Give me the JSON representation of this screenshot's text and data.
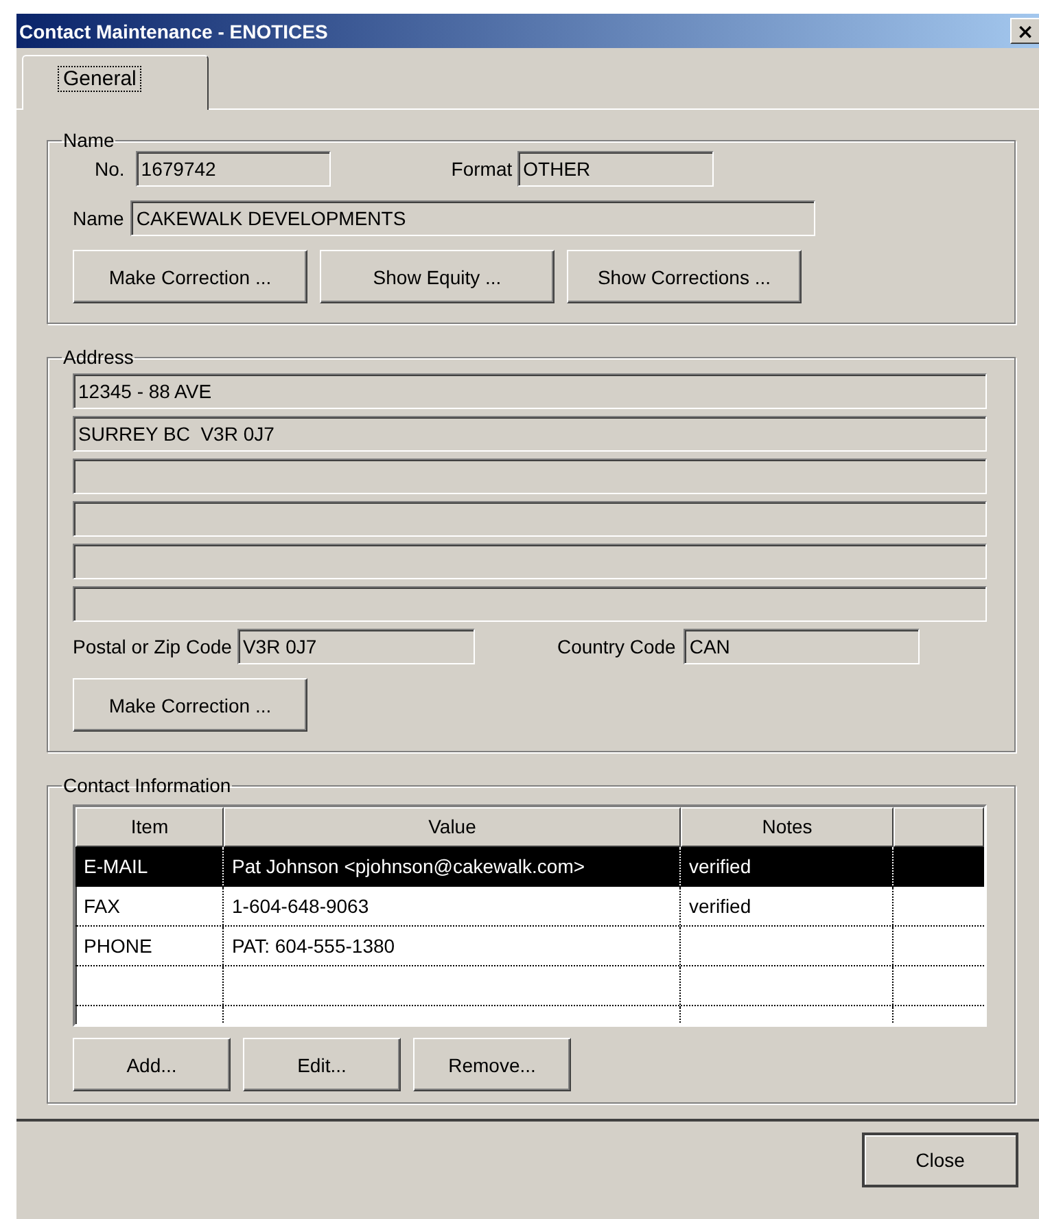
{
  "window": {
    "title": "Contact Maintenance - ENOTICES",
    "close_glyph": "×"
  },
  "tabs": [
    {
      "label": "General",
      "selected": true
    }
  ],
  "name_group": {
    "title": "Name",
    "number_label": "No.",
    "number": "1679742",
    "format_label": "Format",
    "format": "OTHER",
    "name_label": "Name",
    "name": "CAKEWALK DEVELOPMENTS",
    "buttons": [
      "Make Correction ...",
      "Show Equity ...",
      "Show Corrections ..."
    ]
  },
  "address_group": {
    "title": "Address",
    "lines": [
      {
        "kind": "filled",
        "value": "12345 - 88 AVE"
      },
      {
        "kind": "filled",
        "value": "SURREY BC  V3R 0J7"
      },
      {
        "kind": "empty"
      },
      {
        "kind": "empty"
      },
      {
        "kind": "empty"
      },
      {
        "kind": "empty"
      }
    ],
    "postal_label": "Postal or Zip Code",
    "postal": "V3R 0J7",
    "country_label": "Country Code",
    "country": "CAN",
    "buttons": [
      "Make Correction ..."
    ]
  },
  "contact_group": {
    "title": "Contact Information",
    "table": {
      "columns": [
        {
          "kind": "text",
          "label": "Item"
        },
        {
          "kind": "text",
          "label": "Value"
        },
        {
          "kind": "text",
          "label": "Notes"
        },
        {
          "kind": "blank"
        }
      ],
      "rows": [
        {
          "kind": "filled",
          "selected": true,
          "item": "E-MAIL",
          "value": "Pat Johnson <pjohnson@cakewalk.com>",
          "notes": "verified"
        },
        {
          "kind": "filled",
          "selected": false,
          "item": "FAX",
          "value": "1-604-648-9063",
          "notes": "verified"
        },
        {
          "kind": "filled",
          "selected": false,
          "item": "PHONE",
          "value": "PAT: 604-555-1380"
        },
        {
          "kind": "empty",
          "selected": false
        },
        {
          "kind": "empty",
          "selected": false
        }
      ]
    },
    "buttons": [
      "Add...",
      "Edit...",
      "Remove..."
    ]
  },
  "footer_buttons": [
    "Close"
  ]
}
